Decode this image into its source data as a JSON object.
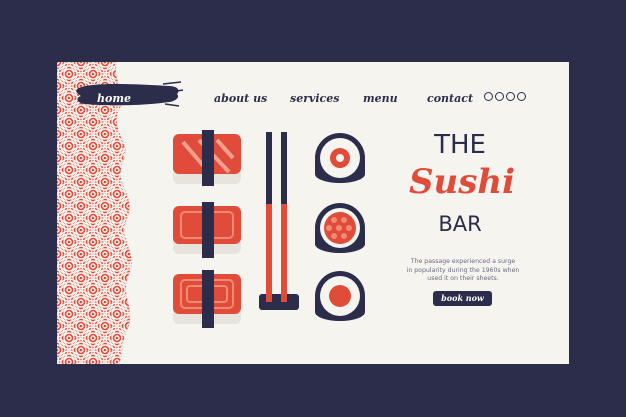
{
  "nav": {
    "home": "home",
    "about": "about us",
    "services": "services",
    "menu": "menu",
    "contact": "contact"
  },
  "social_icons": [
    "instagram-icon",
    "pinterest-icon",
    "facebook-icon",
    "twitter-icon"
  ],
  "hero": {
    "title_top": "THE",
    "title_script": "Sushi",
    "title_bottom": "BAR",
    "description_line1": "The passage experienced a surge",
    "description_line2": "in popularity during the 1960s when",
    "description_line3": "used it on their sheets.",
    "cta": "book now"
  },
  "colors": {
    "background": "#2b2d4a",
    "page": "#f6f4ef",
    "accent": "#e04b3a",
    "dark": "#2b2d4a"
  }
}
